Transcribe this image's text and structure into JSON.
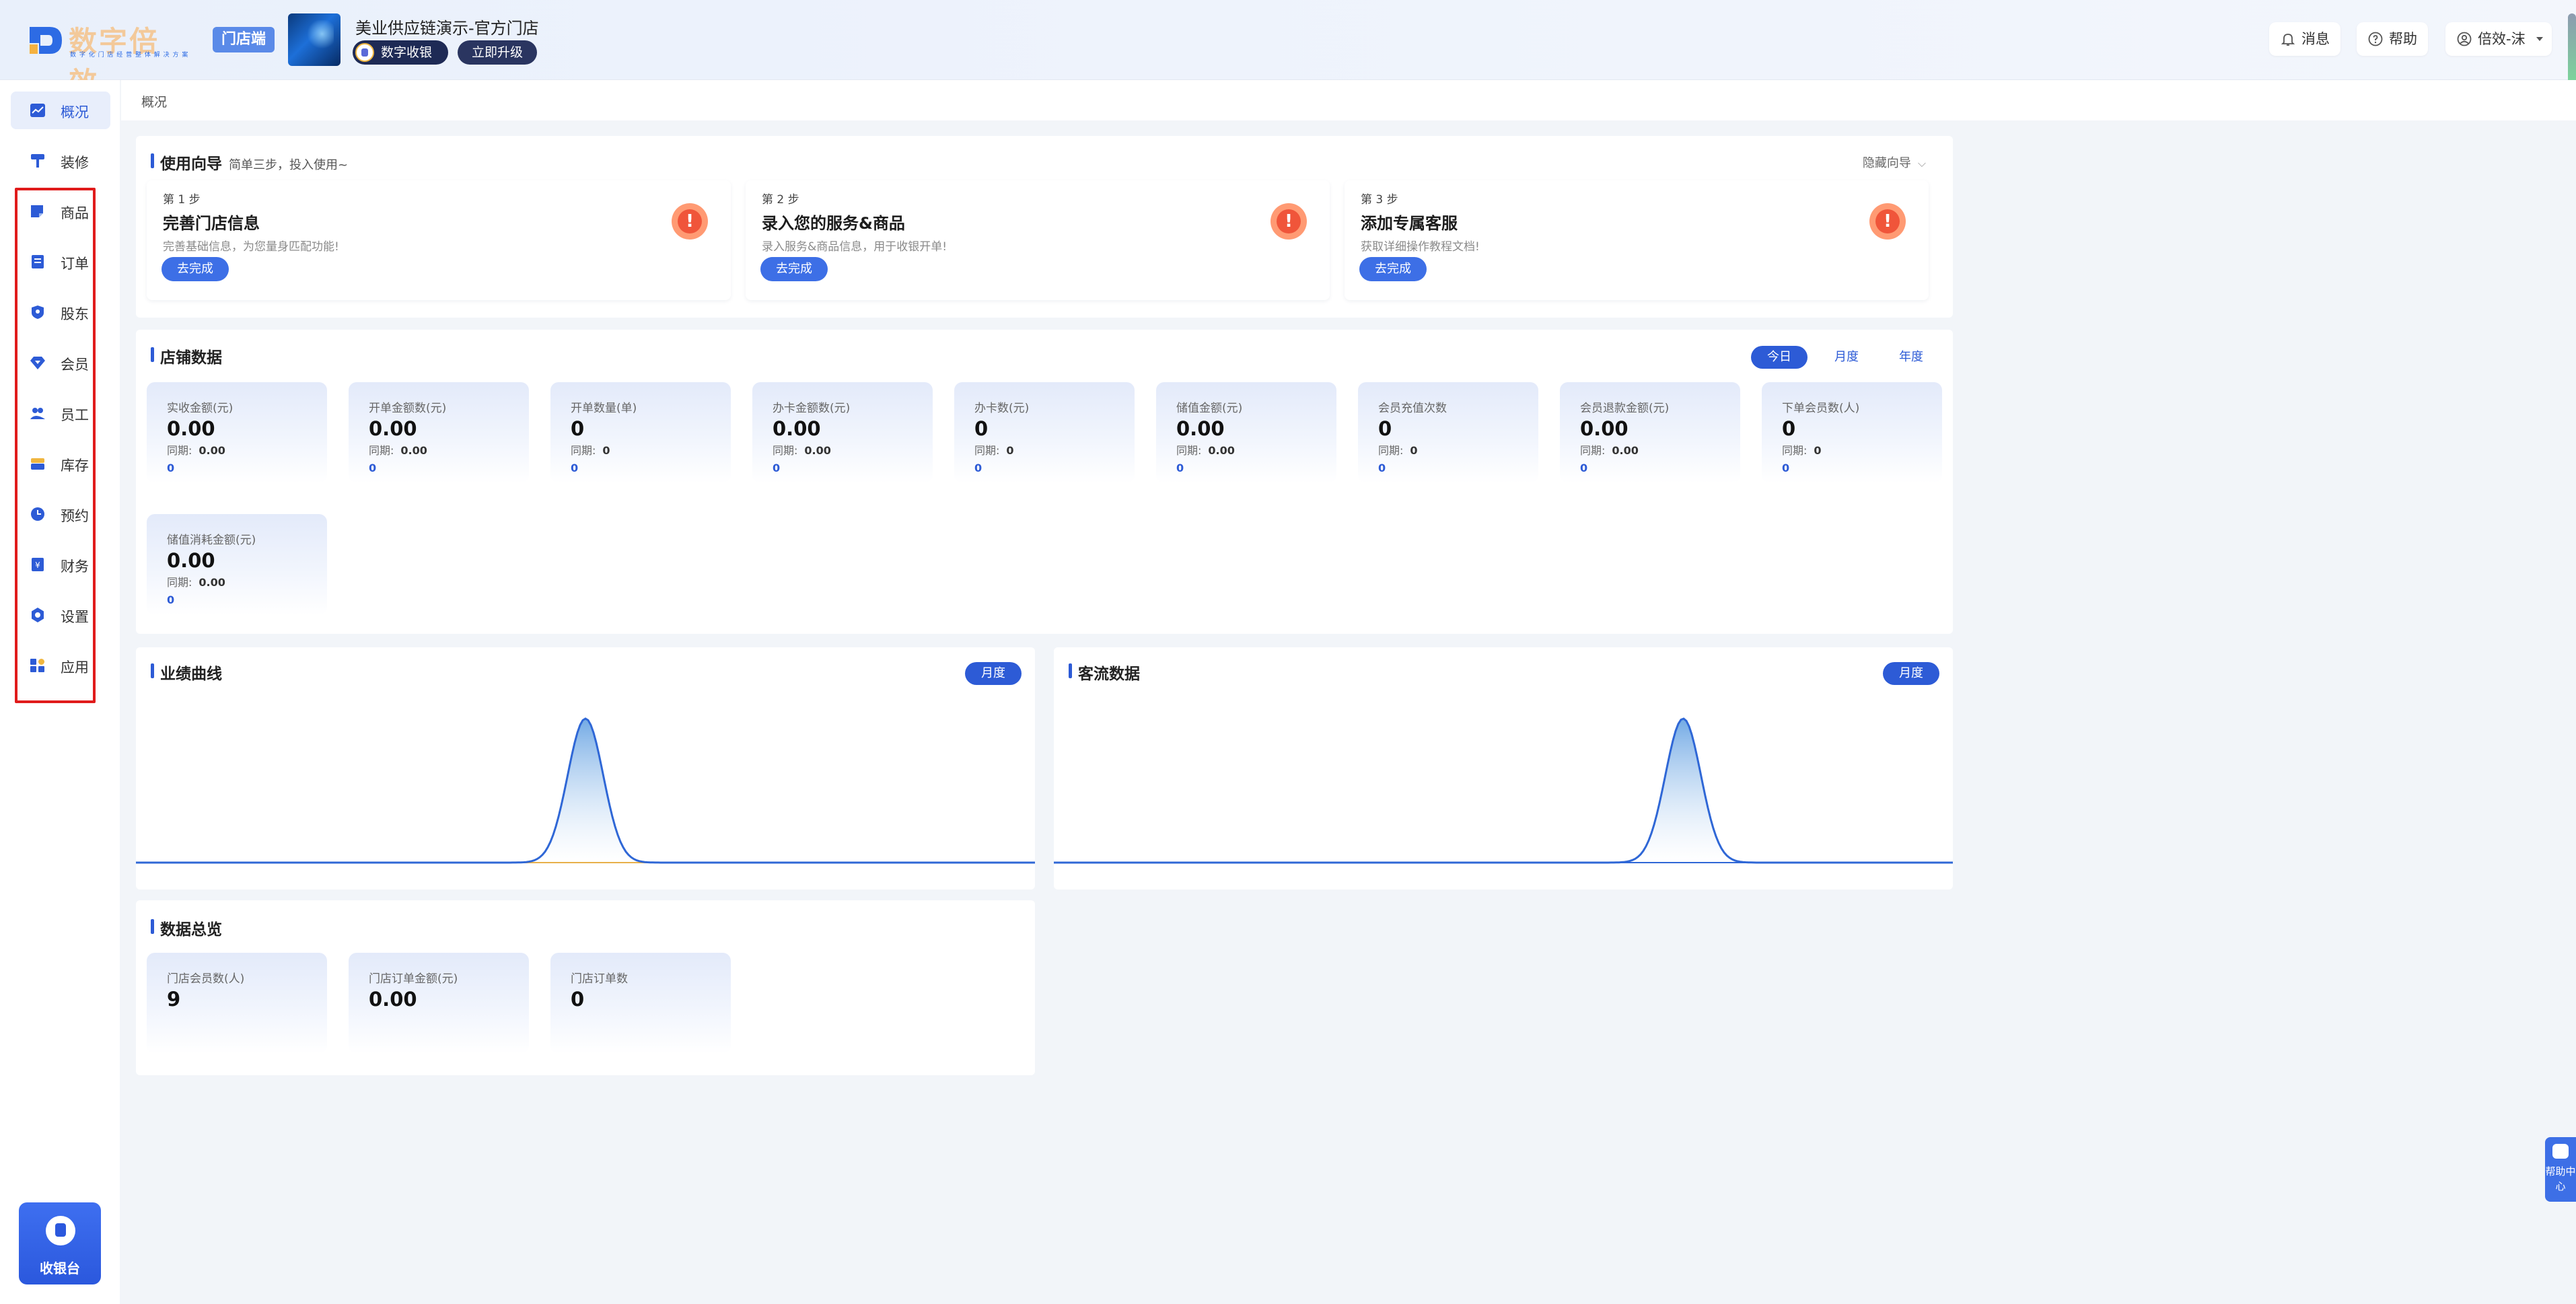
{
  "header": {
    "brand_name": "数字倍效",
    "brand_tagline": "数 字 化 门 店 经 营 整 体 解 决 方 案",
    "store_end_badge": "门店端",
    "store_name": "美业供应链演示-官方门店",
    "cashier_pill": "数字收银",
    "upgrade_pill": "立即升级",
    "messages": "消息",
    "help": "帮助",
    "user": "倍效-沫"
  },
  "sidebar": {
    "items": [
      {
        "label": "概况",
        "icon": "overview-icon"
      },
      {
        "label": "装修",
        "icon": "paint-roller-icon"
      },
      {
        "label": "商品",
        "icon": "goods-icon"
      },
      {
        "label": "订单",
        "icon": "order-icon"
      },
      {
        "label": "股东",
        "icon": "shareholder-icon"
      },
      {
        "label": "会员",
        "icon": "member-diamond-icon"
      },
      {
        "label": "员工",
        "icon": "staff-icon"
      },
      {
        "label": "库存",
        "icon": "inventory-icon"
      },
      {
        "label": "预约",
        "icon": "clock-icon"
      },
      {
        "label": "财务",
        "icon": "finance-icon"
      },
      {
        "label": "设置",
        "icon": "settings-icon"
      },
      {
        "label": "应用",
        "icon": "apps-icon"
      }
    ],
    "cashier_button": "收银台"
  },
  "breadcrumb": "概况",
  "guide": {
    "title": "使用向导",
    "subtitle": "简单三步，投入使用~",
    "hide_label": "隐藏向导",
    "steps": [
      {
        "step": "第 1 步",
        "title": "完善门店信息",
        "desc": "完善基础信息，为您量身匹配功能!",
        "button": "去完成"
      },
      {
        "step": "第 2 步",
        "title": "录入您的服务&商品",
        "desc": "录入服务&商品信息，用于收银开单!",
        "button": "去完成"
      },
      {
        "step": "第 3 步",
        "title": "添加专属客服",
        "desc": "获取详细操作教程文档!",
        "button": "去完成"
      }
    ]
  },
  "store_data": {
    "title": "店铺数据",
    "tabs": [
      "今日",
      "月度",
      "年度"
    ],
    "active_tab": "今日",
    "period_label": "同期:",
    "stats": [
      {
        "label": "实收金额(元)",
        "value": "0.00",
        "period": "0.00",
        "change": "0"
      },
      {
        "label": "开单金额数(元)",
        "value": "0.00",
        "period": "0.00",
        "change": "0"
      },
      {
        "label": "开单数量(单)",
        "value": "0",
        "period": "0",
        "change": "0"
      },
      {
        "label": "办卡金额数(元)",
        "value": "0.00",
        "period": "0.00",
        "change": "0"
      },
      {
        "label": "办卡数(元)",
        "value": "0",
        "period": "0",
        "change": "0"
      },
      {
        "label": "储值金额(元)",
        "value": "0.00",
        "period": "0.00",
        "change": "0"
      },
      {
        "label": "会员充值次数",
        "value": "0",
        "period": "0",
        "change": "0"
      },
      {
        "label": "会员退款金额(元)",
        "value": "0.00",
        "period": "0.00",
        "change": "0"
      },
      {
        "label": "下单会员数(人)",
        "value": "0",
        "period": "0",
        "change": "0"
      },
      {
        "label": "储值消耗金额(元)",
        "value": "0.00",
        "period": "0.00",
        "change": "0"
      }
    ]
  },
  "performance": {
    "title": "业绩曲线",
    "pill": "月度"
  },
  "traffic": {
    "title": "客流数据",
    "pill": "月度"
  },
  "overview": {
    "title": "数据总览",
    "stats": [
      {
        "label": "门店会员数(人)",
        "value": "9"
      },
      {
        "label": "门店订单金额(元)",
        "value": "0.00"
      },
      {
        "label": "门店订单数",
        "value": "0"
      }
    ]
  },
  "help_side": "帮助中心",
  "chart_data": [
    {
      "type": "area",
      "x": [
        1,
        2,
        3,
        4,
        5,
        6,
        7,
        8,
        9,
        10,
        11
      ],
      "series": [
        {
          "values": [
            0,
            0,
            0,
            0,
            0,
            1,
            0,
            0,
            0,
            0,
            0
          ]
        }
      ],
      "colors": {
        "line": "#2f67d6",
        "fill_top": "#5a9be0",
        "baseline": "#e8b04a"
      }
    },
    {
      "type": "area",
      "x": [
        1,
        2,
        3,
        4,
        5,
        6,
        7,
        8,
        9,
        10,
        11
      ],
      "series": [
        {
          "values": [
            0,
            0,
            0,
            0,
            0,
            0,
            0,
            1,
            0,
            0,
            0
          ]
        }
      ],
      "colors": {
        "line": "#2f67d6",
        "fill_top": "#5a9be0",
        "baseline": "#2f67d6"
      }
    }
  ]
}
